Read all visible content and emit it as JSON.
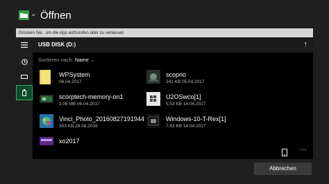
{
  "app": {
    "title": "Öffnen",
    "icon": "folder-app-icon"
  },
  "hint": "Drücken Sie  , um die App aufzurufen oder zu verlassen.",
  "location": "USB DISK (D:)",
  "sort": {
    "label": "Sortieren nach:",
    "value": "Name"
  },
  "items": [
    {
      "name": "WPSystem",
      "meta": "06.04.2017",
      "icon": "folder-icon"
    },
    {
      "name": "scoprio",
      "meta": "241 KB 05.04.2017",
      "icon": "image-thumbnail"
    },
    {
      "name": "scorptech-memory-on1",
      "meta": "2,06 MB 06.04.2017",
      "icon": "image-thumbnail"
    },
    {
      "name": "U2OSwco[1]",
      "meta": "5,53 KB 14.04.2017",
      "icon": "image-thumbnail"
    },
    {
      "name": "Vinci_Photo_20160827191944",
      "meta": "353 KB 28.08.2016",
      "icon": "image-thumbnail"
    },
    {
      "name": "Windows-10-T-Rex[1]",
      "meta": "7,63 KB 14.04.2017",
      "icon": "image-thumbnail"
    },
    {
      "name": "xo2017",
      "meta": "",
      "icon": "image-thumbnail"
    }
  ],
  "buttons": {
    "cancel": "Abbrechen"
  },
  "colors": {
    "accent": "#3fa86a",
    "selected_bg": "#0c4a2f",
    "folder": "#f4e27a"
  }
}
